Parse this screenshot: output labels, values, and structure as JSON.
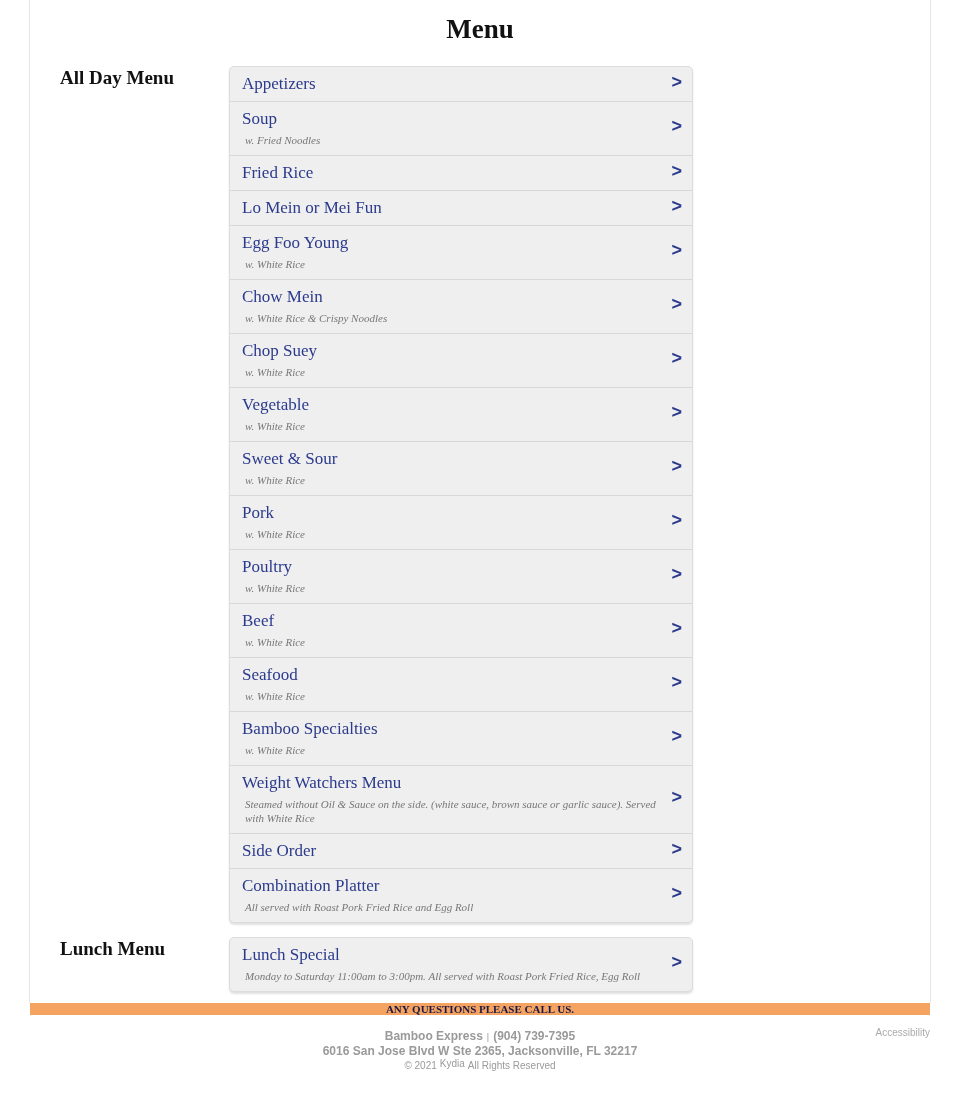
{
  "title": "Menu",
  "sections": [
    {
      "title": "All Day Menu",
      "items": [
        {
          "name": "Appetizers",
          "arrow": ">"
        },
        {
          "name": "Soup",
          "note": "w. Fried Noodles",
          "arrow": ">"
        },
        {
          "name": "Fried Rice",
          "arrow": ">"
        },
        {
          "name": "Lo Mein or Mei Fun",
          "arrow": ">"
        },
        {
          "name": "Egg Foo Young",
          "note": "w. White Rice",
          "arrow": ">"
        },
        {
          "name": "Chow Mein",
          "note": "w. White Rice & Crispy Noodles",
          "arrow": ">"
        },
        {
          "name": "Chop Suey",
          "note": "w. White Rice",
          "arrow": ">"
        },
        {
          "name": "Vegetable",
          "note": "w. White Rice",
          "arrow": ">"
        },
        {
          "name": "Sweet & Sour",
          "note": "w. White Rice",
          "arrow": ">"
        },
        {
          "name": "Pork",
          "note": "w. White Rice",
          "arrow": ">"
        },
        {
          "name": "Poultry",
          "note": "w. White Rice",
          "arrow": ">"
        },
        {
          "name": "Beef",
          "note": "w. White Rice",
          "arrow": ">"
        },
        {
          "name": "Seafood",
          "note": "w. White Rice",
          "arrow": ">"
        },
        {
          "name": "Bamboo Specialties",
          "note": "w. White Rice",
          "arrow": ">"
        },
        {
          "name": "Weight Watchers Menu",
          "note": "Steamed without Oil & Sauce on the side. (white sauce, brown sauce or garlic sauce). Served with White Rice",
          "arrow": ">"
        },
        {
          "name": "Side Order",
          "arrow": ">"
        },
        {
          "name": "Combination Platter",
          "note": "All served with Roast Pork Fried Rice and Egg Roll",
          "arrow": ">"
        }
      ]
    },
    {
      "title": "Lunch Menu",
      "items": [
        {
          "name": "Lunch Special",
          "note": "Monday to Saturday 11:00am to 3:00pm. All served with Roast Pork Fried Rice, Egg Roll",
          "arrow": ">"
        }
      ]
    }
  ],
  "banner": "ANY QUESTIONS PLEASE CALL US.",
  "footer": {
    "business": "Bamboo Express",
    "separator": "|",
    "phone": "(904) 739-7395",
    "address": "6016 San Jose Blvd W Ste 2365, Jacksonville, FL 32217",
    "copyright": "© 2021",
    "brand": "Kydia",
    "rights": "All Rights Reserved",
    "accessibility": "Accessibility"
  }
}
